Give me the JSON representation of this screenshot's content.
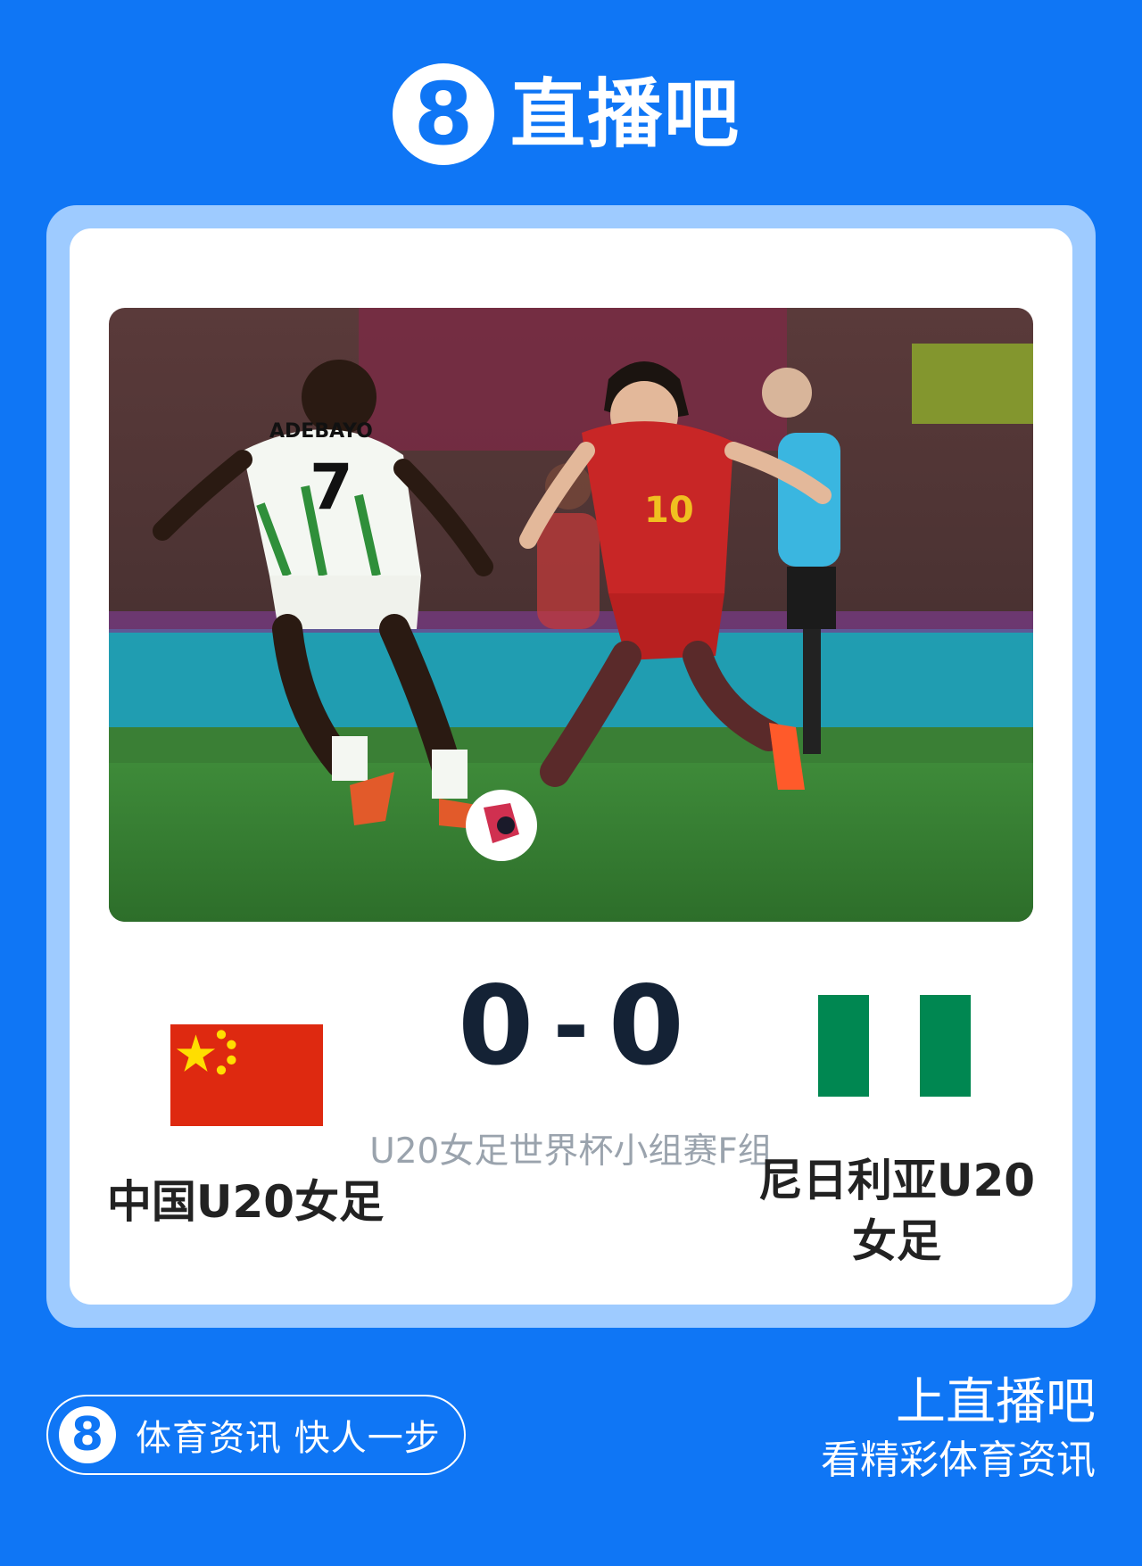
{
  "brand": {
    "logo_glyph": "8",
    "name": "直播吧"
  },
  "match": {
    "home_team": "中国U20女足",
    "away_team": "尼日利亚U20女足",
    "home_score": "0",
    "separator": "-",
    "away_score": "0",
    "competition": "U20女足世界杯小组赛F组"
  },
  "photo": {
    "jersey_name": "ADEBAYO",
    "jersey_number_white": "7",
    "jersey_number_red": "10"
  },
  "footer": {
    "logo_glyph": "8",
    "slogan": "体育资讯 快人一步",
    "cta_title": "上直播吧",
    "cta_sub": "看精彩体育资讯"
  },
  "colors": {
    "background": "#0f76f5",
    "card_border": "#9ecbff",
    "china_red": "#de2910",
    "china_star": "#ffde00",
    "nigeria_green": "#008751"
  }
}
